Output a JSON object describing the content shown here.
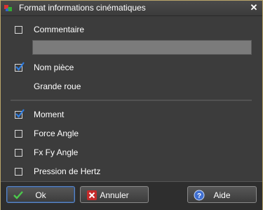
{
  "window": {
    "title": "Format informations cinématiques",
    "close_glyph": "✕"
  },
  "options": {
    "comment": {
      "label": "Commentaire",
      "checked": false,
      "value": ""
    },
    "part_name": {
      "label": "Nom pièce",
      "checked": true,
      "value": "Grande roue"
    },
    "moment": {
      "label": "Moment",
      "checked": true
    },
    "force_angle": {
      "label": "Force Angle",
      "checked": false
    },
    "fx_fy_angle": {
      "label": "Fx Fy Angle",
      "checked": false
    },
    "hertz": {
      "label": "Pression de Hertz",
      "checked": false
    }
  },
  "buttons": {
    "ok": {
      "label": "Ok",
      "icon": "check-icon"
    },
    "cancel": {
      "label": "Annuler",
      "icon": "cancel-icon"
    },
    "help": {
      "label": "Aide",
      "icon": "help-icon"
    }
  },
  "colors": {
    "window_bg": "#3c3c3c",
    "check_mark": "#2f7de1",
    "field_bg": "#7b7b7b",
    "ok_border": "#5c86c4"
  }
}
